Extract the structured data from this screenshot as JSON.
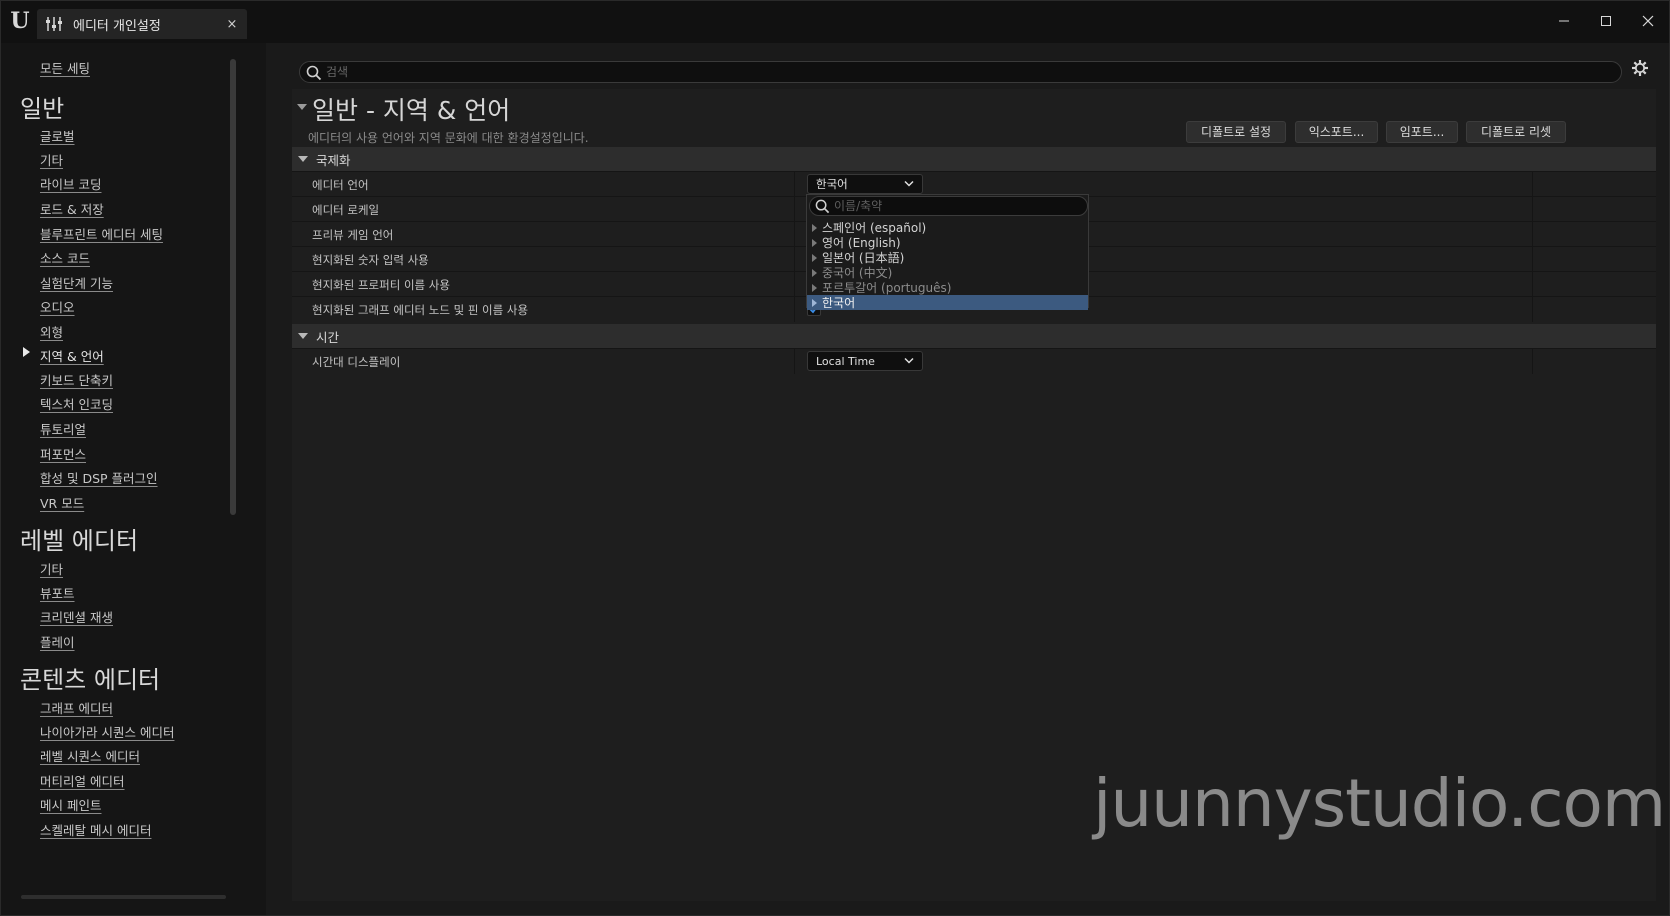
{
  "window": {
    "tab_title": "에디터 개인설정",
    "tab_close": "×"
  },
  "sidebar": {
    "all_settings": "모든 세팅",
    "categories": [
      {
        "title": "일반",
        "items": [
          "글로벌",
          "기타",
          "라이브 코딩",
          "로드 & 저장",
          "블루프린트 에디터 세팅",
          "소스 코드",
          "실험단계 기능",
          "오디오",
          "외형",
          "지역 & 언어",
          "키보드 단축키",
          "텍스처 인코딩",
          "튜토리얼",
          "퍼포먼스",
          "합성 및 DSP 플러그인",
          "VR 모드"
        ]
      },
      {
        "title": "레벨 에디터",
        "items": [
          "기타",
          "뷰포트",
          "크리덴셜 재생",
          "플레이"
        ]
      },
      {
        "title": "콘텐츠 에디터",
        "items": [
          "그래프 에디터",
          "나이아가라 시퀀스 에디터",
          "레벨 시퀀스 에디터",
          "머티리얼 에디터",
          "메시 페인트",
          "스켈레탈 메시 에디터"
        ]
      }
    ],
    "active_item": "지역 & 언어"
  },
  "main": {
    "search_placeholder": "검색",
    "title": "일반 - 지역 & 언어",
    "description": "에디터의 사용 언어와 지역 문화에 대한 환경설정입니다.",
    "buttons": {
      "set_default": "디폴트로 설정",
      "export": "익스포트...",
      "import": "임포트...",
      "reset_default": "디폴트로 리셋"
    },
    "sections": [
      {
        "title": "국제화",
        "properties": [
          "에디터 언어",
          "에디터 로케일",
          "프리뷰 게임 언어",
          "현지화된 숫자 입력 사용",
          "현지화된 프로퍼티 이름 사용",
          "현지화된 그래프 에디터 노드 및 핀 이름 사용"
        ]
      },
      {
        "title": "시간",
        "properties": [
          "시간대 디스플레이"
        ]
      }
    ],
    "editor_language_value": "한국어",
    "timezone_value": "Local Time",
    "graph_names_checked": true
  },
  "language_popup": {
    "search_placeholder": "이름/축약",
    "items": [
      "스페인어 (español)",
      "영어 (English)",
      "일본어 (日本語)",
      "중국어 (中文)",
      "포르투갈어 (português)",
      "한국어"
    ],
    "selected": "한국어"
  },
  "watermark": "juunnystudio.com",
  "colors": {
    "background": "#1a1a1a",
    "category_row": "#2d2d2d",
    "selection": "#3c5a80",
    "check": "#3b8ee8"
  }
}
